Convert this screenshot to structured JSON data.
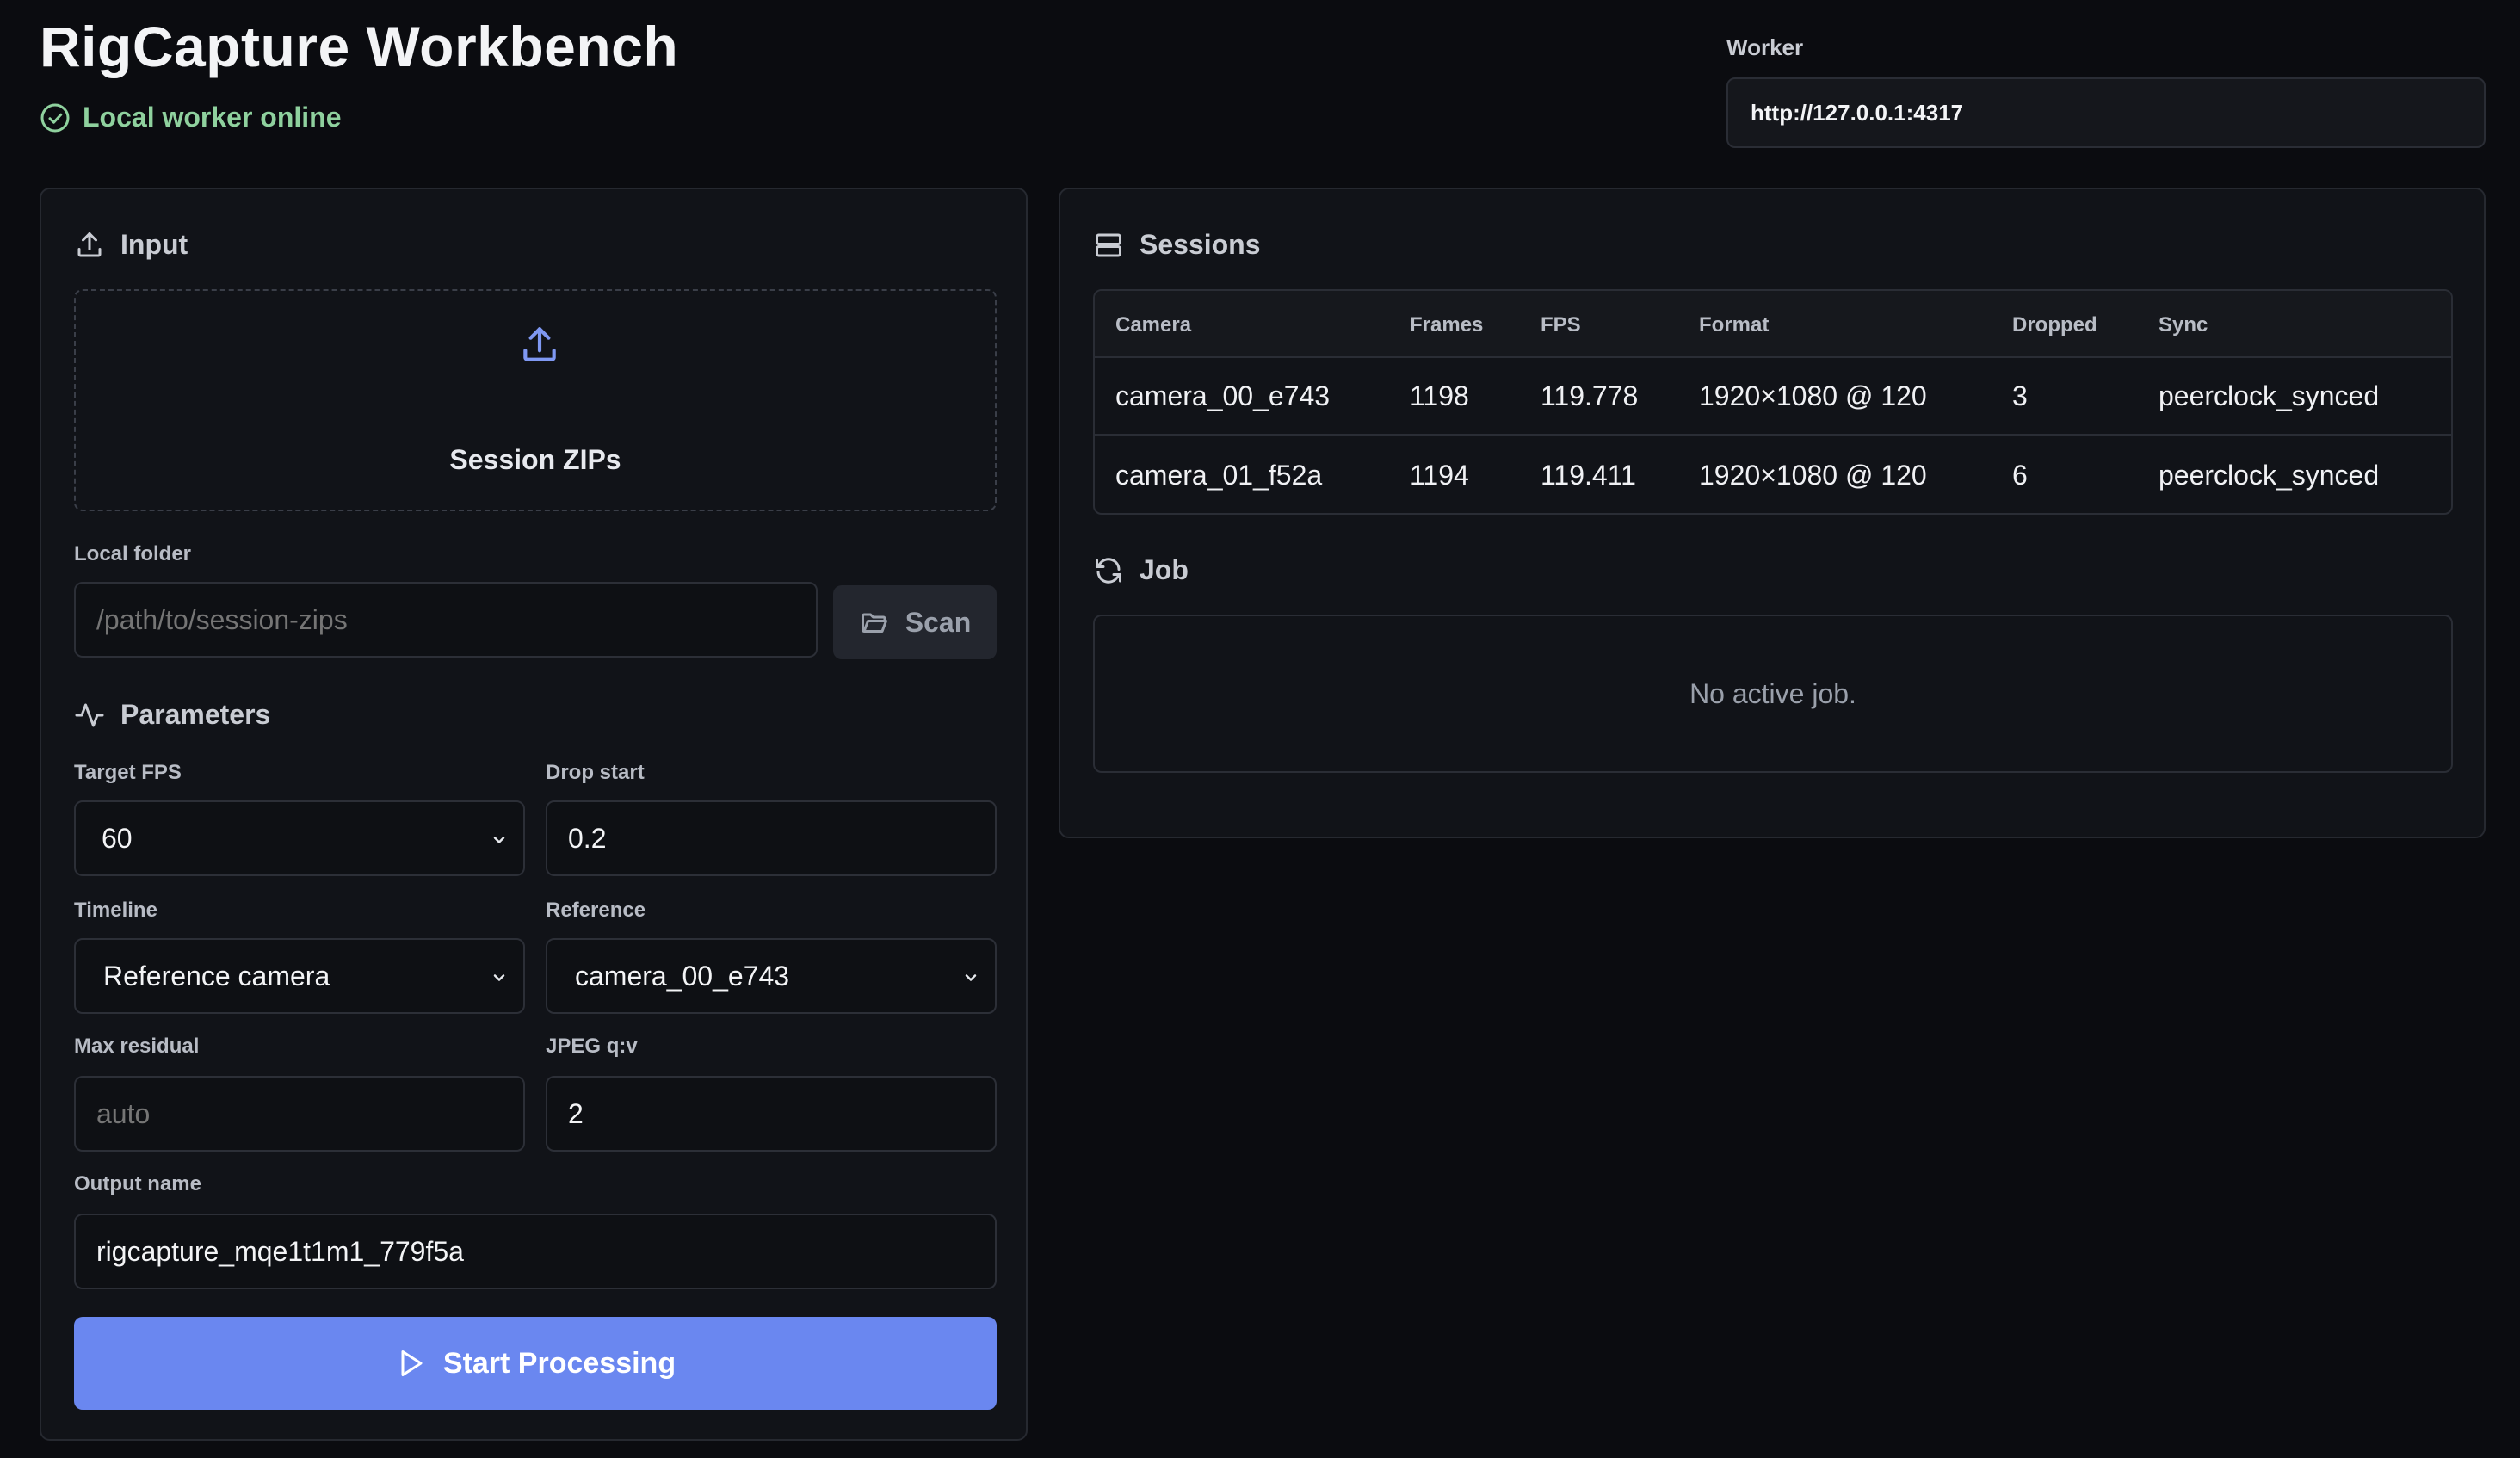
{
  "header": {
    "title": "RigCapture Workbench",
    "status": "Local worker online",
    "status_color": "#8fd19e"
  },
  "worker": {
    "label": "Worker",
    "url": "http://127.0.0.1:4317"
  },
  "input": {
    "heading": "Input",
    "dropzone_label": "Session ZIPs",
    "local_folder_label": "Local folder",
    "local_folder_placeholder": "/path/to/session-zips",
    "scan_label": "Scan"
  },
  "parameters": {
    "heading": "Parameters",
    "target_fps": {
      "label": "Target FPS",
      "value": "60"
    },
    "drop_start": {
      "label": "Drop start",
      "value": "0.2"
    },
    "timeline": {
      "label": "Timeline",
      "value": "Reference camera"
    },
    "reference": {
      "label": "Reference",
      "value": "camera_00_e743"
    },
    "max_residual": {
      "label": "Max residual",
      "placeholder": "auto"
    },
    "jpeg_qv": {
      "label": "JPEG q:v",
      "value": "2"
    },
    "output_name": {
      "label": "Output name",
      "value": "rigcapture_mqe1t1m1_779f5a"
    },
    "start_label": "Start Processing",
    "accent": "#6a87f0"
  },
  "sessions": {
    "heading": "Sessions",
    "columns": [
      "Camera",
      "Frames",
      "FPS",
      "Format",
      "Dropped",
      "Sync"
    ],
    "rows": [
      [
        "camera_00_e743",
        "1198",
        "119.778",
        "1920×1080 @ 120",
        "3",
        "peerclock_synced"
      ],
      [
        "camera_01_f52a",
        "1194",
        "119.411",
        "1920×1080 @ 120",
        "6",
        "peerclock_synced"
      ]
    ]
  },
  "job": {
    "heading": "Job",
    "empty_text": "No active job."
  },
  "icons": {
    "status": "check-circle-icon",
    "input": "upload-icon",
    "dropzone": "upload-icon",
    "scan": "folder-open-icon",
    "parameters": "activity-icon",
    "sessions": "server-icon",
    "job": "refresh-icon",
    "start": "play-icon",
    "select": "chevron-down-icon"
  }
}
